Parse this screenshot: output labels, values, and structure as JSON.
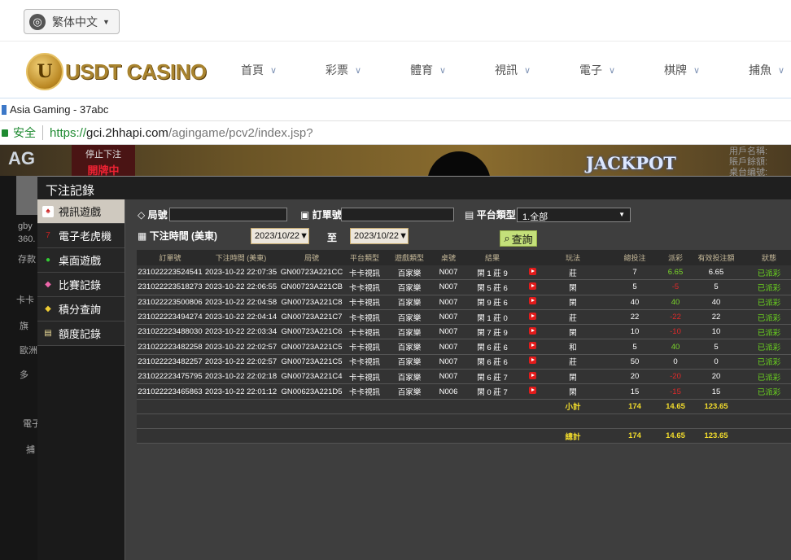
{
  "lang": {
    "label": "繁体中文"
  },
  "casino": {
    "logo_letter": "U",
    "logo_text": "USDT CASINO",
    "nav": [
      "首頁",
      "彩票",
      "體育",
      "視訊",
      "電子",
      "棋牌",
      "捕魚"
    ]
  },
  "browser": {
    "title": "Asia Gaming - 37abc",
    "secure": "安全",
    "url_proto": "https://",
    "url_host": "gci.2hhapi.com",
    "url_path": "/agingame/pcv2/index.jsp?"
  },
  "app": {
    "ag": "AG",
    "stop_label": "停止下注",
    "stop_status": "開牌中",
    "jackpot": "JACKPOT",
    "right_info": [
      "用戶名稱:",
      "賬戶餘額:",
      "桌台编號:"
    ],
    "left_lines": [
      "gby",
      "360.",
      "存款",
      "卡卡",
      "旗",
      "歐洲",
      "多",
      "電子",
      "捕"
    ]
  },
  "dialog": {
    "title": "下注記錄",
    "menu": [
      {
        "label": "視訊遊戲",
        "icon": "cards-icon",
        "glyph": "♠"
      },
      {
        "label": "電子老虎機",
        "icon": "slot-machine-icon",
        "glyph": "7"
      },
      {
        "label": "桌面遊戲",
        "icon": "dice-icon",
        "glyph": "●"
      },
      {
        "label": "比賽記錄",
        "icon": "ticket-icon",
        "glyph": "◆"
      },
      {
        "label": "積分查詢",
        "icon": "diamond-icon",
        "glyph": "◆"
      },
      {
        "label": "額度記錄",
        "icon": "document-icon",
        "glyph": "▤"
      }
    ],
    "filters": {
      "ju_label": "局號",
      "order_label": "訂單號",
      "platform_label": "平台類型",
      "platform_value": "1.全部",
      "time_label": "下注時間 (美東)",
      "date_from": "2023/10/22",
      "to_label": "至",
      "date_to": "2023/10/22",
      "query": "查詢"
    },
    "table": {
      "headers": [
        "訂單號",
        "下注時間 (美東)",
        "局號",
        "平台類型",
        "遊戲類型",
        "桌號",
        "結果",
        "",
        "玩法",
        "總投注",
        "派彩",
        "有效投注額",
        "狀態"
      ],
      "rows": [
        {
          "order": "231022223524541",
          "time": "2023-10-22 22:07:35",
          "round": "GN00723A221CC",
          "platform": "卡卡視訊",
          "game": "百家樂",
          "table": "N007",
          "result": "閑 1 莊 9",
          "play": "莊",
          "bet": "7",
          "payout": "6.65",
          "payout_sign": "pos",
          "valid": "6.65",
          "status": "已派彩"
        },
        {
          "order": "231022223518273",
          "time": "2023-10-22 22:06:55",
          "round": "GN00723A221CB",
          "platform": "卡卡視訊",
          "game": "百家樂",
          "table": "N007",
          "result": "閑 5 莊 6",
          "play": "閑",
          "bet": "5",
          "payout": "-5",
          "payout_sign": "neg",
          "valid": "5",
          "status": "已派彩"
        },
        {
          "order": "231022223500806",
          "time": "2023-10-22 22:04:58",
          "round": "GN00723A221C8",
          "platform": "卡卡視訊",
          "game": "百家樂",
          "table": "N007",
          "result": "閑 9 莊 6",
          "play": "閑",
          "bet": "40",
          "payout": "40",
          "payout_sign": "pos",
          "valid": "40",
          "status": "已派彩"
        },
        {
          "order": "231022223494274",
          "time": "2023-10-22 22:04:14",
          "round": "GN00723A221C7",
          "platform": "卡卡視訊",
          "game": "百家樂",
          "table": "N007",
          "result": "閑 1 莊 0",
          "play": "莊",
          "bet": "22",
          "payout": "-22",
          "payout_sign": "neg",
          "valid": "22",
          "status": "已派彩"
        },
        {
          "order": "231022223488030",
          "time": "2023-10-22 22:03:34",
          "round": "GN00723A221C6",
          "platform": "卡卡視訊",
          "game": "百家樂",
          "table": "N007",
          "result": "閑 7 莊 9",
          "play": "閑",
          "bet": "10",
          "payout": "-10",
          "payout_sign": "neg",
          "valid": "10",
          "status": "已派彩"
        },
        {
          "order": "231022223482258",
          "time": "2023-10-22 22:02:57",
          "round": "GN00723A221C5",
          "platform": "卡卡視訊",
          "game": "百家樂",
          "table": "N007",
          "result": "閑 6 莊 6",
          "play": "和",
          "bet": "5",
          "payout": "40",
          "payout_sign": "pos",
          "valid": "5",
          "status": "已派彩"
        },
        {
          "order": "231022223482257",
          "time": "2023-10-22 22:02:57",
          "round": "GN00723A221C5",
          "platform": "卡卡視訊",
          "game": "百家樂",
          "table": "N007",
          "result": "閑 6 莊 6",
          "play": "莊",
          "bet": "50",
          "payout": "0",
          "payout_sign": "zero",
          "valid": "0",
          "status": "已派彩"
        },
        {
          "order": "231022223475795",
          "time": "2023-10-22 22:02:18",
          "round": "GN00723A221C4",
          "platform": "卡卡視訊",
          "game": "百家樂",
          "table": "N007",
          "result": "閑 6 莊 7",
          "play": "閑",
          "bet": "20",
          "payout": "-20",
          "payout_sign": "neg",
          "valid": "20",
          "status": "已派彩"
        },
        {
          "order": "231022223465863",
          "time": "2023-10-22 22:01:12",
          "round": "GN00623A221D5",
          "platform": "卡卡視訊",
          "game": "百家樂",
          "table": "N006",
          "result": "閑 0 莊 7",
          "play": "閑",
          "bet": "15",
          "payout": "-15",
          "payout_sign": "neg",
          "valid": "15",
          "status": "已派彩"
        }
      ],
      "subtotal": {
        "label": "小計",
        "bet": "174",
        "payout": "14.65",
        "valid": "123.65"
      },
      "total": {
        "label": "總計",
        "bet": "174",
        "payout": "14.65",
        "valid": "123.65"
      }
    }
  }
}
